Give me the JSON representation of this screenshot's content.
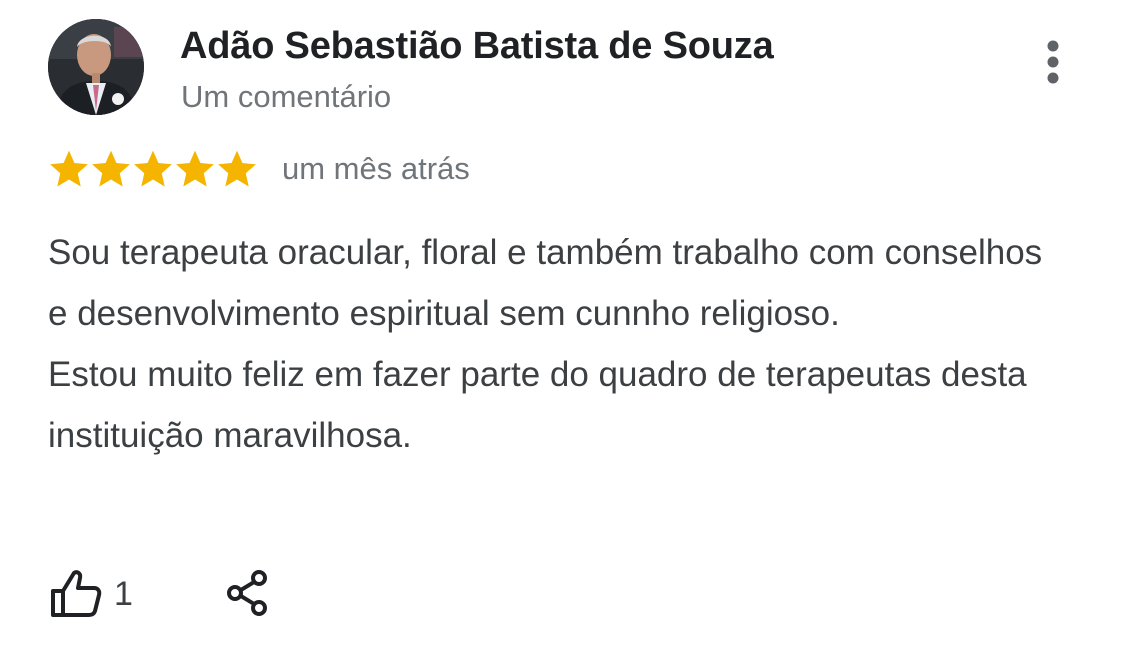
{
  "review": {
    "author": {
      "name": "Adão Sebastião Batista de Souza",
      "review_count": "Um comentário",
      "avatar_icon": "profile-photo"
    },
    "rating": {
      "value": 5,
      "max": 5,
      "star_color": "#f4b400"
    },
    "date": "um mês atrás",
    "text_paragraphs": [
      "Sou terapeuta oracular, floral e também trabalho com conselhos e desenvolvimento espiritual sem cunnho religioso.",
      "Estou muito feliz em fazer parte do quadro de terapeutas desta instituição maravilhosa."
    ],
    "actions": {
      "like_icon": "thumbs-up-icon",
      "like_count": "1",
      "share_icon": "share-icon",
      "menu_icon": "more-vert-icon"
    }
  }
}
